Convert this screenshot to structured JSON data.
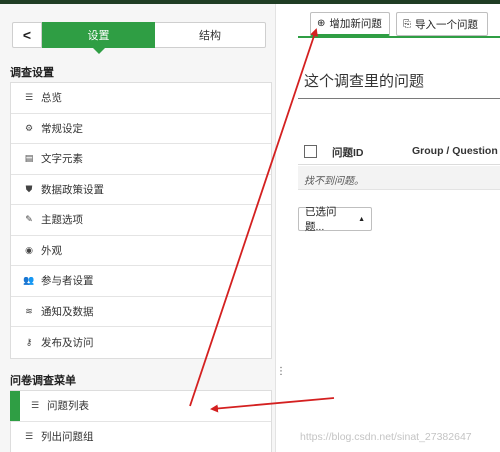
{
  "sidebar": {
    "collapse_icon": "chevron-left-icon",
    "collapse_glyph": "<",
    "tabs": {
      "settings": "设置",
      "structure": "结构"
    },
    "survey_settings_heading": "调查设置",
    "settings_items": [
      {
        "icon": "list-icon",
        "glyph": "☰",
        "label": "总览"
      },
      {
        "icon": "gears-icon",
        "glyph": "⚙",
        "label": "常规设定"
      },
      {
        "icon": "file-text-icon",
        "glyph": "▤",
        "label": "文字元素"
      },
      {
        "icon": "shield-icon",
        "glyph": "⛊",
        "label": "数据政策设置"
      },
      {
        "icon": "paint-brush-icon",
        "glyph": "✎",
        "label": "主题选项"
      },
      {
        "icon": "eye-icon",
        "glyph": "◉",
        "label": "外观"
      },
      {
        "icon": "users-icon",
        "glyph": "👥",
        "label": "参与者设置"
      },
      {
        "icon": "rss-icon",
        "glyph": "≋",
        "label": "通知及数据"
      },
      {
        "icon": "key-icon",
        "glyph": "⚷",
        "label": "发布及访问"
      }
    ],
    "survey_menu_heading": "问卷调查菜单",
    "survey_menu_items": [
      {
        "icon": "list-icon",
        "glyph": "☰",
        "label": "问题列表",
        "active": true
      },
      {
        "icon": "list-icon",
        "glyph": "☰",
        "label": "列出问题组",
        "active": false
      }
    ]
  },
  "toolbar": {
    "add_icon": "plus-circle-icon",
    "add_glyph": "⊕",
    "add_label": "增加新问题",
    "import_icon": "import-icon",
    "import_glyph": "⎘",
    "import_label": "导入一个问题"
  },
  "main": {
    "title": "这个调查里的问题",
    "table": {
      "columns": [
        "问题ID",
        "Group / Question o"
      ],
      "empty_message": "找不到问题。"
    },
    "selected_button": "已选问题...",
    "selected_caret": "▲"
  },
  "watermark": "https://blog.csdn.net/sinat_27382647",
  "colors": {
    "accent_green": "#2f9e44",
    "annotation_red": "#d42020"
  }
}
